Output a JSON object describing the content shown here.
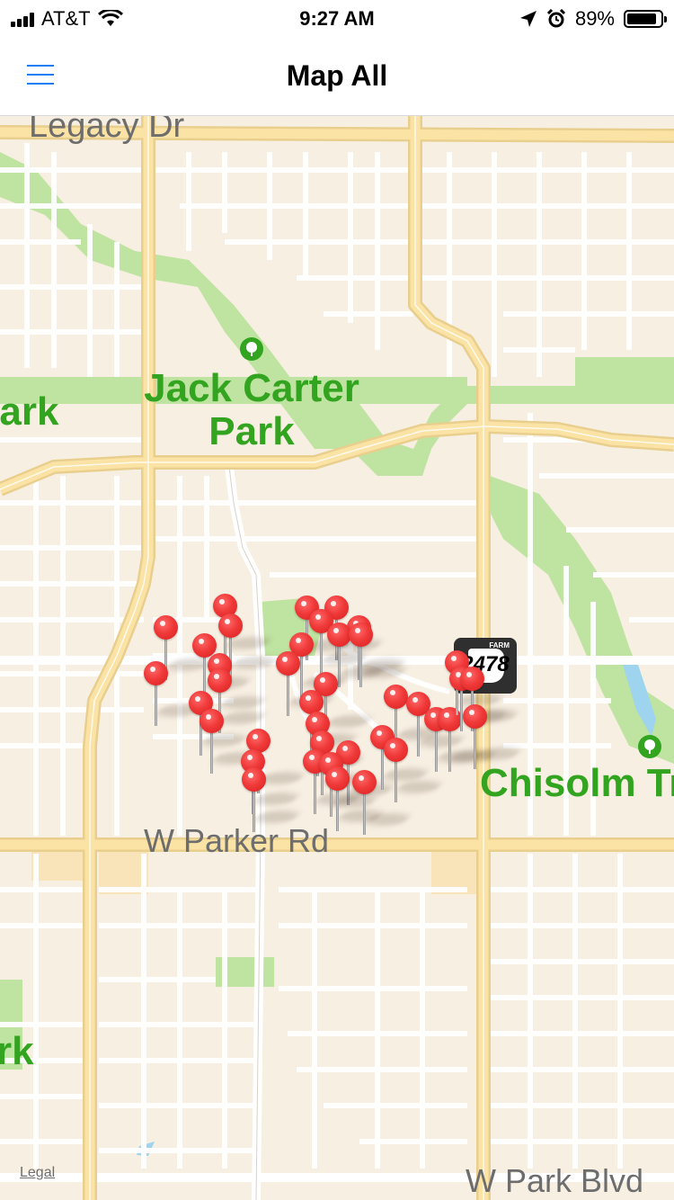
{
  "status_bar": {
    "carrier": "AT&T",
    "time": "9:27 AM",
    "battery_percent": "89%",
    "battery_level": 0.89
  },
  "nav": {
    "title": "Map All",
    "menu_icon": "hamburger-menu-icon",
    "accent_color": "#1a7ef2"
  },
  "map": {
    "road_labels": {
      "legacy": "Legacy Dr",
      "parker": "W Parker Rd",
      "park_blvd": "W Park Blvd"
    },
    "park_labels": {
      "jack_carter": "Jack Carter Park",
      "chisolm": "Chisolm Tr",
      "park_left_top": "Park",
      "park_left_bottom": "rk"
    },
    "shield": {
      "farm": "FARM",
      "number": "2478"
    },
    "legal": "Legal",
    "colors": {
      "land": "#f7efe2",
      "park": "#bfe3a0",
      "major_road": "#fbe3a6",
      "park_text": "#32a41f",
      "pin": "#f03a3a"
    }
  }
}
